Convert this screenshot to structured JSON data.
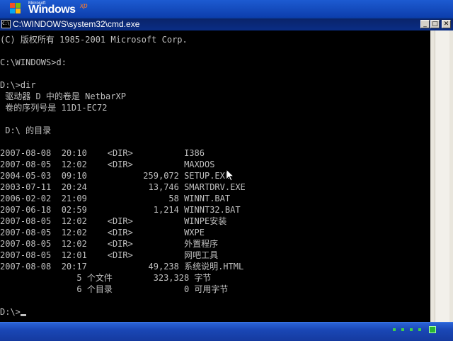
{
  "desktop": {
    "logo_small": "Microsoft",
    "logo_windows": "Windows",
    "logo_xp": "xp"
  },
  "window": {
    "title": "C:\\WINDOWS\\system32\\cmd.exe",
    "icon_text": "C:\\",
    "minimize_label": "_",
    "restore_label": "□",
    "close_label": "✕"
  },
  "console": {
    "lines": [
      "(C) 版权所有 1985-2001 Microsoft Corp.",
      "",
      "C:\\WINDOWS>d:",
      "",
      "D:\\>dir",
      " 驱动器 D 中的卷是 NetbarXP",
      " 卷的序列号是 11D1-EC72",
      "",
      " D:\\ 的目录",
      "",
      "2007-08-08  20:10    <DIR>          I386",
      "2007-08-05  12:02    <DIR>          MAXDOS",
      "2004-05-03  09:10           259,072 SETUP.EXE",
      "2003-07-11  20:24            13,746 SMARTDRV.EXE",
      "2006-02-02  21:09                58 WINNT.BAT",
      "2007-06-18  02:59             1,214 WINNT32.BAT",
      "2007-08-05  12:02    <DIR>          WINPE安装",
      "2007-08-05  12:02    <DIR>          WXPE",
      "2007-08-05  12:02    <DIR>          外置程序",
      "2007-08-05  12:01    <DIR>          网吧工具",
      "2007-08-08  20:17            49,238 系统说明.HTML",
      "               5 个文件        323,328 字节",
      "               6 个目录              0 可用字节",
      "",
      "D:\\>"
    ]
  }
}
